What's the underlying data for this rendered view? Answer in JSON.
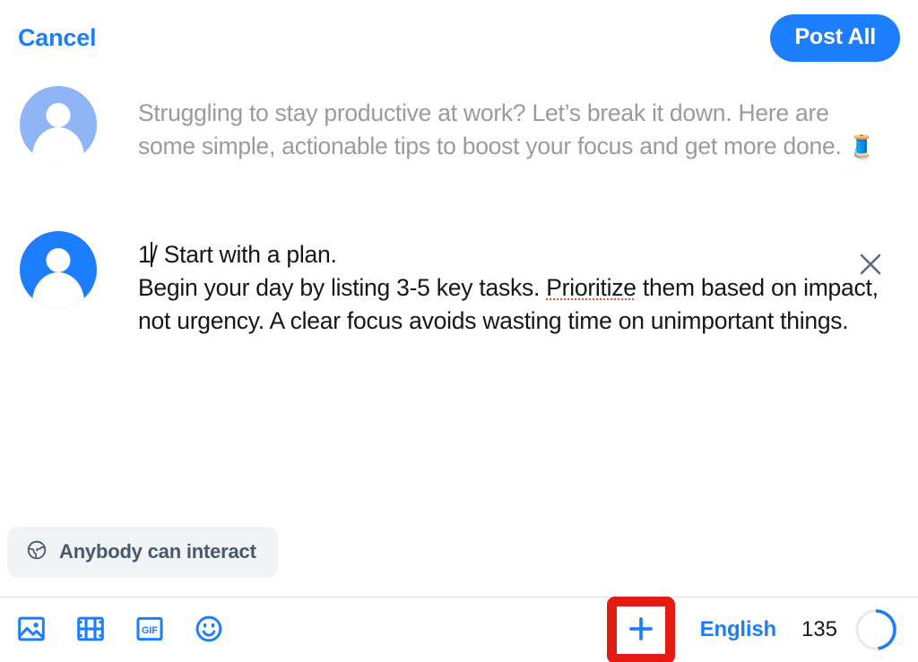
{
  "header": {
    "cancel_label": "Cancel",
    "post_all_label": "Post All"
  },
  "composer": {
    "posts": [
      {
        "avatar_icon": "user-avatar-icon",
        "state": "placeholder",
        "text": "Struggling to stay productive at work? Let’s break it down. Here are some simple, actionable tips to boost your focus and get more done. 🧵",
        "text_before_emoji": "Struggling to stay productive at work? Let’s break it down. Here are some simple, actionable tips to boost your focus and get more done. ",
        "emoji": "🧵"
      },
      {
        "avatar_icon": "user-avatar-icon",
        "state": "filled",
        "text": "1/ Start with a plan.\nBegin your day by listing 3-5 key tasks. Prioritize them based on impact, not urgency. A clear focus avoids wasting time on unimportant things.",
        "segment_1": "1",
        "segment_2": "/ Start with a plan.\nBegin your day by listing 3-5 key tasks. ",
        "misspelled_word": "Prioritize",
        "segment_3": " them based on impact, not urgency. A clear focus avoids wasting time on unimportant things.",
        "close_icon": "close-icon"
      }
    ]
  },
  "audience": {
    "icon": "globe-icon",
    "label": "Anybody can interact"
  },
  "toolbar": {
    "tools": [
      {
        "icon": "image-icon",
        "name": "add-image-button"
      },
      {
        "icon": "video-icon",
        "name": "add-video-button"
      },
      {
        "icon": "gif-icon",
        "name": "add-gif-button",
        "text": "GIF"
      },
      {
        "icon": "emoji-icon",
        "name": "add-emoji-button"
      }
    ],
    "add_post": {
      "icon": "plus-icon",
      "highlighted": true,
      "highlight_color": "#e31b12"
    },
    "language_label": "English",
    "char_count": "135",
    "progress_percent": 48
  },
  "colors": {
    "accent_blue": "#1d7efd",
    "muted_blue": "#8fb5f7",
    "placeholder_gray": "#9b9b9b",
    "text_dark": "#14171a",
    "chip_bg": "#f1f3f5",
    "chip_text": "#48596d",
    "highlight_red": "#e31b12",
    "spellcheck_red": "#e8533f",
    "divider": "#dfe4ea"
  }
}
